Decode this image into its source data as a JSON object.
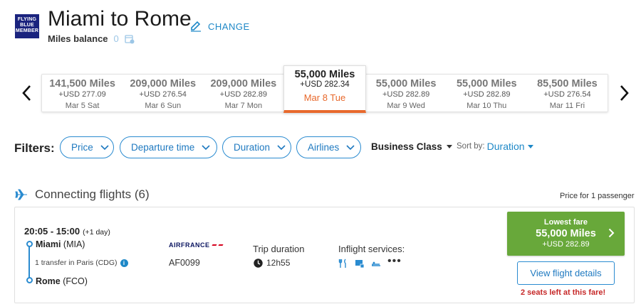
{
  "header": {
    "logo_lines": [
      "FLYING",
      "BLUE",
      "MEMBER"
    ],
    "title": "Miami to Rome",
    "change_label": "CHANGE",
    "miles_balance_label": "Miles balance",
    "miles_balance_value": "0"
  },
  "dates": [
    {
      "miles": "141,500 Miles",
      "usd": "+USD 277.09",
      "day": "Mar 5 Sat",
      "active": false
    },
    {
      "miles": "209,000 Miles",
      "usd": "+USD 276.54",
      "day": "Mar 6 Sun",
      "active": false
    },
    {
      "miles": "209,000 Miles",
      "usd": "+USD 282.89",
      "day": "Mar 7 Mon",
      "active": false
    },
    {
      "miles": "55,000 Miles",
      "usd": "+USD 282.34",
      "day": "Mar 8 Tue",
      "active": true
    },
    {
      "miles": "55,000 Miles",
      "usd": "+USD 282.89",
      "day": "Mar 9 Wed",
      "active": false
    },
    {
      "miles": "55,000 Miles",
      "usd": "+USD 282.89",
      "day": "Mar 10 Thu",
      "active": false
    },
    {
      "miles": "85,500 Miles",
      "usd": "+USD 276.54",
      "day": "Mar 11 Fri",
      "active": false
    }
  ],
  "filters": {
    "label": "Filters:",
    "pills": [
      "Price",
      "Departure time",
      "Duration",
      "Airlines"
    ],
    "cabin": "Business Class",
    "sort_label": "Sort by:",
    "sort_value": "Duration"
  },
  "results": {
    "section_title": "Connecting flights (6)",
    "price_for": "Price for 1 passenger"
  },
  "flight": {
    "times": "20:05 - 15:00",
    "plus_day": "(+1 day)",
    "origin_city": "Miami",
    "origin_code": "(MIA)",
    "transfer": "1 transfer in Paris (CDG)",
    "dest_city": "Rome",
    "dest_code": "(FCO)",
    "airline_logo_text": "AIRFRANCE",
    "flight_number": "AF0099",
    "trip_duration_label": "Trip duration",
    "trip_duration": "12h55",
    "inflight_label": "Inflight services:",
    "more_services": "•••",
    "lowest_label": "Lowest fare",
    "lowest_miles": "55,000 Miles",
    "lowest_usd": "+USD 282.89",
    "view_details": "View flight details",
    "seats_left": "2 seats left at this fare!"
  },
  "colors": {
    "accent_blue": "#1e88c7",
    "active_orange": "#e8692c",
    "fare_green": "#68a83a",
    "warning_red": "#c62828",
    "logo_navy": "#1a237e"
  }
}
